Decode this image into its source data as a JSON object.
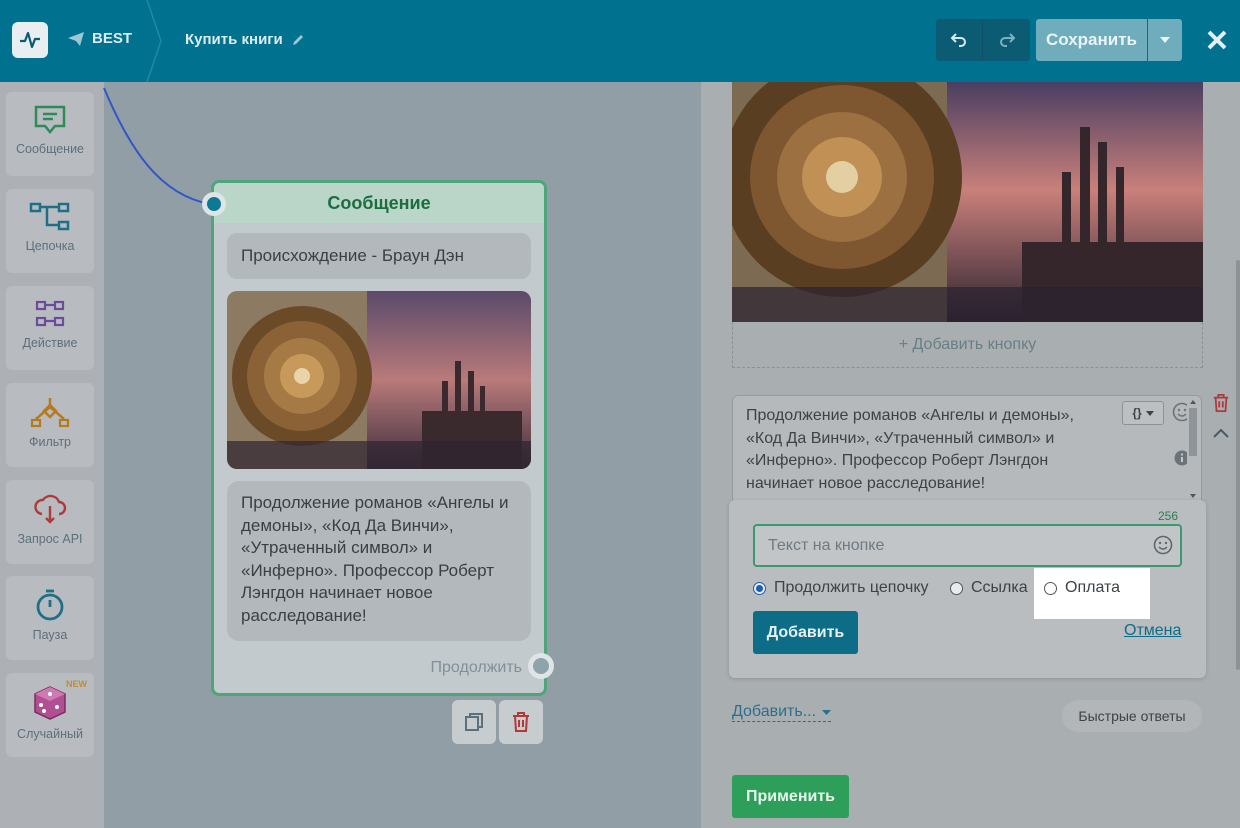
{
  "header": {
    "project_name": "BEST",
    "flow_name": "Купить книги",
    "save_label": "Сохранить"
  },
  "sidebar": {
    "items": [
      {
        "label": "Сообщение",
        "icon": "message-icon"
      },
      {
        "label": "Цепочка",
        "icon": "chain-icon"
      },
      {
        "label": "Действие",
        "icon": "action-icon"
      },
      {
        "label": "Фильтр",
        "icon": "filter-icon"
      },
      {
        "label": "Запрос API",
        "icon": "api-request-icon"
      },
      {
        "label": "Пауза",
        "icon": "pause-timer-icon"
      },
      {
        "label": "Случайный",
        "icon": "dice-icon",
        "badge": "NEW"
      }
    ]
  },
  "node": {
    "header": "Сообщение",
    "title": "Происхождение - Браун Дэн",
    "text": "Продолжение романов «Ангелы и демоны», «Код Да Винчи», «Утраченный символ» и «Инферно». Профессор Роберт Лэнгдон начинает новое расследование!",
    "continue_label": "Продолжить"
  },
  "editor": {
    "add_button_label": "+ Добавить кнопку",
    "message_text": "Продолжение романов «Ангелы и демоны», «Код Да Винчи», «Утраченный символ» и «Инферно». Профессор Роберт Лэнгдон начинает новое расследование!",
    "var_label": "{}"
  },
  "button_form": {
    "counter": "256",
    "input_placeholder": "Текст на кнопке",
    "options": [
      {
        "label": "Продолжить цепочку",
        "selected": true
      },
      {
        "label": "Ссылка",
        "selected": false
      },
      {
        "label": "Оплата",
        "selected": false
      }
    ],
    "add_label": "Добавить",
    "cancel_label": "Отмена"
  },
  "footer": {
    "add_more_label": "Добавить...",
    "quick_replies_label": "Быстрые ответы",
    "apply_label": "Применить"
  },
  "colors": {
    "header_bg": "#00728f",
    "node_border": "#4fa57a",
    "apply_green": "#2e9f5a",
    "primary_teal": "#0d6d87"
  }
}
